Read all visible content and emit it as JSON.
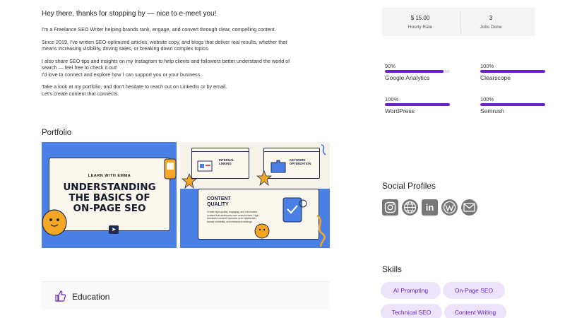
{
  "intro": {
    "greeting": "Hey there, thanks for stopping by — nice to e-meet you!",
    "p1": "I'm a Freelance SEO Writer helping brands rank, engage, and convert through clear, compelling content.",
    "p2": "Since 2019, I've written SEO-optimized articles, website copy, and blogs that deliver real results, whether that means increasing visibility, driving sales, or breaking down complex topics.",
    "p3a": "I also share SEO tips and insights on my Instagram to help clients and followers better understand the world of search — feel free to check it out!",
    "p3b": "I'd love to connect and explore how I can support you or your business.",
    "p4a": "Take a look at my portfolio, and don't hesitate to reach out on LinkedIn or by email.",
    "p4b": "Let's create content that connects."
  },
  "portfolio": {
    "title": "Portfolio",
    "main": {
      "learn": "LEARN WITH EMMA",
      "line1": "UNDERSTANDING",
      "line2": "THE BASICS OF",
      "line3": "ON-PAGE SEO"
    },
    "side": {
      "mini1": "INTERNAL LINKING",
      "mini2": "KEYWORD OPTIMIZATION",
      "card_title_1": "CONTENT",
      "card_title_2": "QUALITY",
      "card_desc": "Create high-quality, engaging, and informative content that addresses user search intent. High-structured content improves user satisfaction, boosts credibility, and enhances rankings."
    }
  },
  "education": {
    "label": "Education"
  },
  "stats": {
    "rate_value": "$ 15.00",
    "rate_label": "Hourly Rate",
    "jobs_value": "3",
    "jobs_label": "Jobs Done"
  },
  "skill_levels": [
    {
      "pct": "90%",
      "value": 0.9,
      "name": "Google Analytics"
    },
    {
      "pct": "100%",
      "value": 1.0,
      "name": "Clearscope"
    },
    {
      "pct": "100%",
      "value": 1.0,
      "name": "WordPress"
    },
    {
      "pct": "100%",
      "value": 1.0,
      "name": "Semrush"
    }
  ],
  "social": {
    "title": "Social Profiles",
    "icons": [
      "instagram-icon",
      "website-icon",
      "linkedin-icon",
      "wordpress-icon",
      "email-icon"
    ],
    "linkedin_text": "in"
  },
  "skills": {
    "title": "Skills",
    "chips": [
      "AI Prompting",
      "On-Page SEO",
      "Technical SEO",
      "Content Writing"
    ]
  },
  "colors": {
    "accent": "#6a22c8",
    "chip_bg": "#ede4fb",
    "portfolio_blue": "#4a7fe6",
    "icon_gray": "#777777"
  }
}
